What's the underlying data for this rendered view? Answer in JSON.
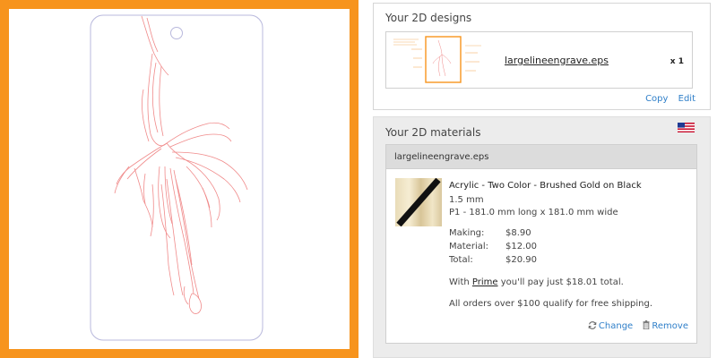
{
  "designs": {
    "title": "Your 2D designs",
    "file_name": "largelineengrave.eps",
    "quantity": "x 1",
    "copy_label": "Copy",
    "edit_label": "Edit"
  },
  "materials": {
    "title": "Your 2D materials",
    "flag_icon": "us-flag-icon",
    "file_name": "largelineengrave.eps",
    "material_name": "Acrylic - Two Color - Brushed Gold on Black",
    "thickness": "1.5 mm",
    "size": "P1 - 181.0 mm long x 181.0 mm wide",
    "prices": [
      {
        "label": "Making:",
        "value": "$8.90"
      },
      {
        "label": "Material:",
        "value": "$12.00"
      },
      {
        "label": "Total:",
        "value": "$20.90"
      }
    ],
    "prime_prefix": "With ",
    "prime_link": "Prime",
    "prime_suffix": " you'll pay just $18.01 total.",
    "shipping_note": "All orders over $100 qualify for free shipping.",
    "change_label": "Change",
    "remove_label": "Remove"
  },
  "colors": {
    "frame": "#f7941d",
    "link": "#2f7fc9",
    "engrave_line": "#f08a8a",
    "outline": "#b8b8dc"
  }
}
